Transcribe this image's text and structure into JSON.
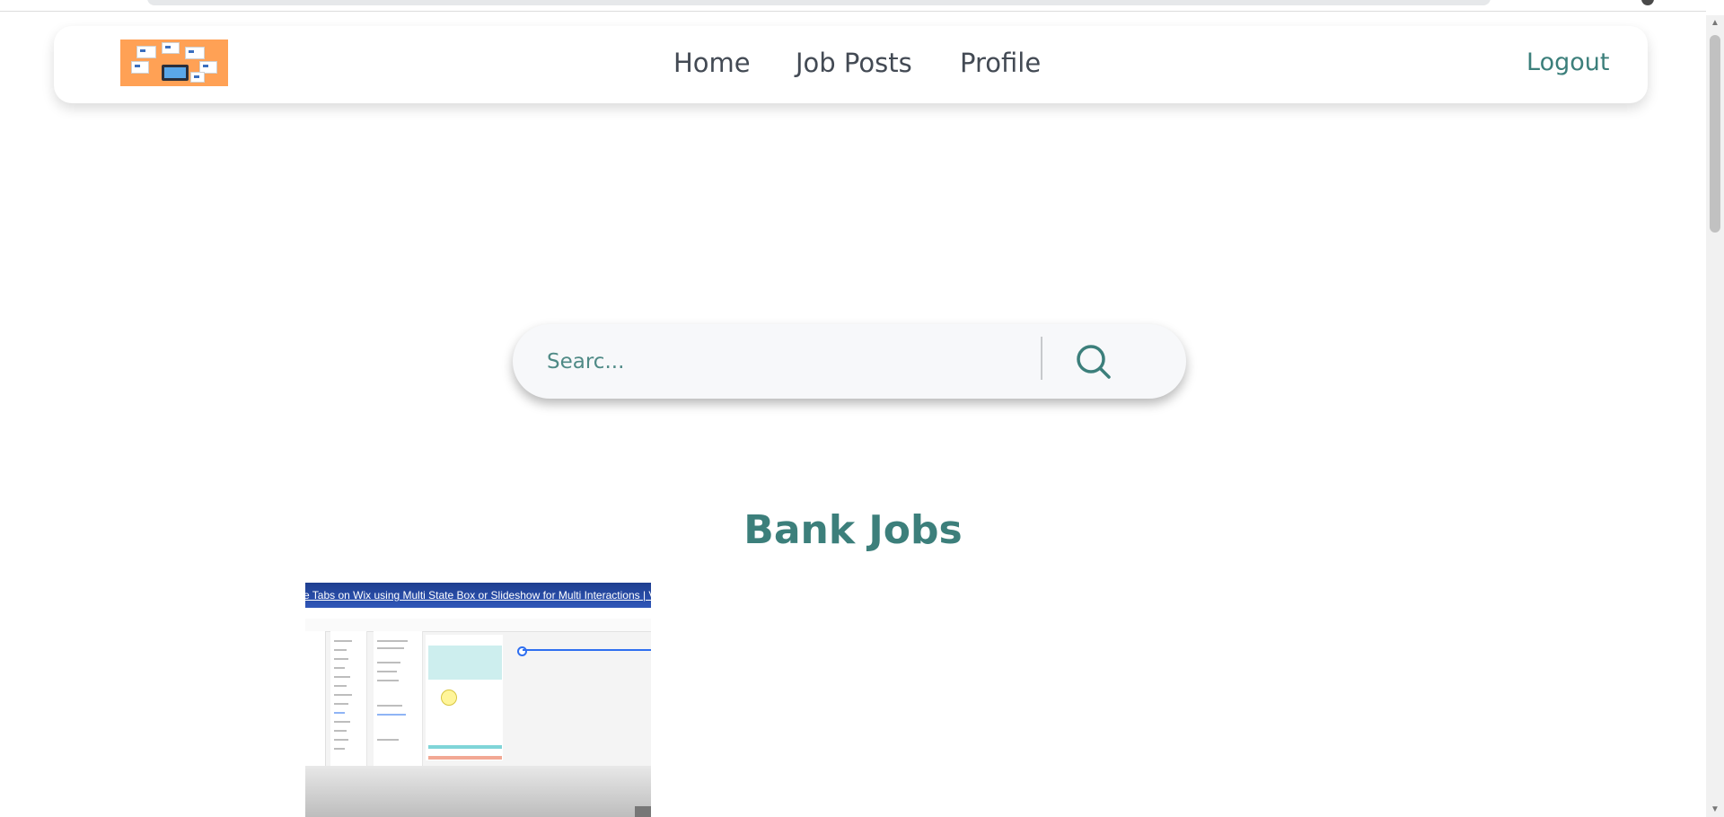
{
  "nav": {
    "items": [
      {
        "label": "Home"
      },
      {
        "label": "Job Posts"
      },
      {
        "label": "Profile"
      }
    ],
    "logout_label": "Logout"
  },
  "search": {
    "placeholder": "Searc...",
    "icon": "search-icon"
  },
  "section": {
    "title": "Bank Jobs"
  },
  "video": {
    "title": "e Tabs on Wix using Multi State Box or Slideshow for Multi Interactions | Velo..."
  },
  "colors": {
    "accent": "#3c7f7b",
    "nav_text": "#434a54",
    "logo_bg": "#ffa155",
    "search_bg": "#f7f8fa"
  },
  "icons": {
    "scroll_up": "▲",
    "scroll_down": "▼"
  }
}
